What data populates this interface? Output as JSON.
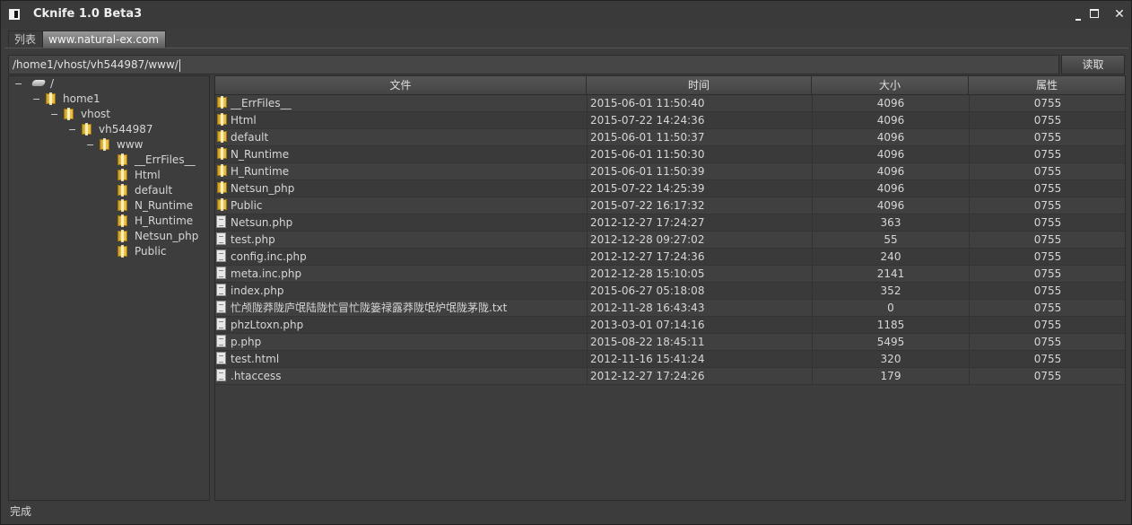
{
  "window": {
    "title": "Cknife 1.0 Beta3"
  },
  "tabs": [
    {
      "label": "列表"
    },
    {
      "label": "www.natural-ex.com"
    }
  ],
  "path_bar": {
    "value": "/home1/vhost/vh544987/www/",
    "read_label": "读取"
  },
  "tree": {
    "root": "/",
    "nodes": [
      {
        "label": "home1"
      },
      {
        "label": "vhost"
      },
      {
        "label": "vh544987"
      },
      {
        "label": "www"
      }
    ],
    "children": [
      "__ErrFiles__",
      "Html",
      "default",
      "N_Runtime",
      "H_Runtime",
      "Netsun_php",
      "Public"
    ]
  },
  "table": {
    "headers": [
      "文件",
      "时间",
      "大小",
      "属性"
    ],
    "rows": [
      {
        "type": "folder",
        "name": "__ErrFiles__",
        "time": "2015-06-01 11:50:40",
        "size": "4096",
        "perm": "0755"
      },
      {
        "type": "folder",
        "name": "Html",
        "time": "2015-07-22 14:24:36",
        "size": "4096",
        "perm": "0755"
      },
      {
        "type": "folder",
        "name": "default",
        "time": "2015-06-01 11:50:37",
        "size": "4096",
        "perm": "0755"
      },
      {
        "type": "folder",
        "name": "N_Runtime",
        "time": "2015-06-01 11:50:30",
        "size": "4096",
        "perm": "0755"
      },
      {
        "type": "folder",
        "name": "H_Runtime",
        "time": "2015-06-01 11:50:39",
        "size": "4096",
        "perm": "0755"
      },
      {
        "type": "folder",
        "name": "Netsun_php",
        "time": "2015-07-22 14:25:39",
        "size": "4096",
        "perm": "0755"
      },
      {
        "type": "folder",
        "name": "Public",
        "time": "2015-07-22 16:17:32",
        "size": "4096",
        "perm": "0755"
      },
      {
        "type": "file",
        "name": "Netsun.php",
        "time": "2012-12-27 17:24:27",
        "size": "363",
        "perm": "0755"
      },
      {
        "type": "file",
        "name": "test.php",
        "time": "2012-12-28 09:27:02",
        "size": "55",
        "perm": "0755"
      },
      {
        "type": "file",
        "name": "config.inc.php",
        "time": "2012-12-27 17:24:36",
        "size": "240",
        "perm": "0755"
      },
      {
        "type": "file",
        "name": "meta.inc.php",
        "time": "2012-12-28 15:10:05",
        "size": "2141",
        "perm": "0755"
      },
      {
        "type": "file",
        "name": "index.php",
        "time": "2015-06-27 05:18:08",
        "size": "352",
        "perm": "0755"
      },
      {
        "type": "file",
        "name": "忙颅陇莽陇庐氓陆陇忙冒忙陇篓禄露莽陇氓炉氓陇茅陇.txt",
        "time": "2012-11-28 16:43:43",
        "size": "0",
        "perm": "0755"
      },
      {
        "type": "file",
        "name": "phzLtoxn.php",
        "time": "2013-03-01 07:14:16",
        "size": "1185",
        "perm": "0755"
      },
      {
        "type": "file",
        "name": "p.php",
        "time": "2015-08-22 18:45:11",
        "size": "5495",
        "perm": "0755"
      },
      {
        "type": "file",
        "name": "test.html",
        "time": "2012-11-16 15:41:24",
        "size": "320",
        "perm": "0755"
      },
      {
        "type": "file",
        "name": ".htaccess",
        "time": "2012-12-27 17:24:26",
        "size": "179",
        "perm": "0755"
      }
    ]
  },
  "status": {
    "text": "完成"
  }
}
